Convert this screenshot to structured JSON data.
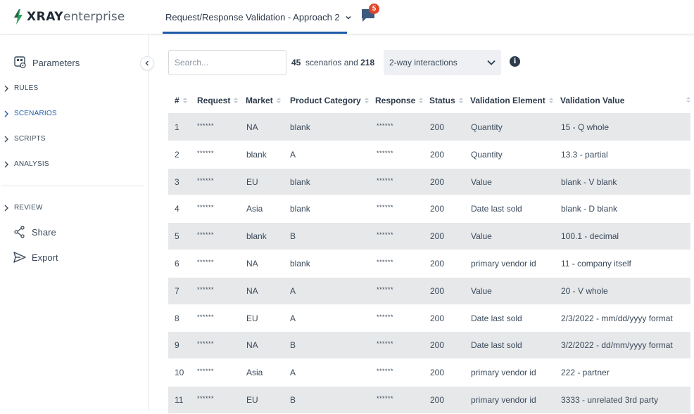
{
  "header": {
    "logo_strong": "XRAY",
    "logo_light": "enterprise",
    "project_title": "Request/Response Validation - Approach 2",
    "notification_count": "5"
  },
  "sidebar": {
    "parameters_label": "Parameters",
    "sections": [
      {
        "label": "RULES",
        "active": false
      },
      {
        "label": "SCENARIOS",
        "active": true
      },
      {
        "label": "SCRIPTS",
        "active": false
      },
      {
        "label": "ANALYSIS",
        "active": false
      },
      {
        "label": "REVIEW",
        "active": false
      }
    ],
    "share_label": "Share",
    "export_label": "Export"
  },
  "toolbar": {
    "search_placeholder": "Search...",
    "scenario_count": "45",
    "scenarios_and": "scenarios and",
    "interaction_count": "218",
    "interaction_select": "2-way interactions"
  },
  "table": {
    "columns": [
      "#",
      "Request",
      "Market",
      "Product Category",
      "Response",
      "Status",
      "Validation Element",
      "Validation Value"
    ],
    "rows": [
      [
        "1",
        "******",
        "NA",
        "blank",
        "******",
        "200",
        "Quantity",
        "15 - Q whole"
      ],
      [
        "2",
        "******",
        "blank",
        "A",
        "******",
        "200",
        "Quantity",
        "13.3 - partial"
      ],
      [
        "3",
        "******",
        "EU",
        "blank",
        "******",
        "200",
        "Value",
        "blank - V blank"
      ],
      [
        "4",
        "******",
        "Asia",
        "blank",
        "******",
        "200",
        "Date last sold",
        "blank - D blank"
      ],
      [
        "5",
        "******",
        "blank",
        "B",
        "******",
        "200",
        "Value",
        "100.1 - decimal"
      ],
      [
        "6",
        "******",
        "NA",
        "blank",
        "******",
        "200",
        "primary vendor id",
        "11 - company itself"
      ],
      [
        "7",
        "******",
        "NA",
        "A",
        "******",
        "200",
        "Value",
        "20 - V whole"
      ],
      [
        "8",
        "******",
        "EU",
        "A",
        "******",
        "200",
        "Date last sold",
        "2/3/2022 - mm/dd/yyyy format"
      ],
      [
        "9",
        "******",
        "NA",
        "B",
        "******",
        "200",
        "Date last sold",
        "3/2/2022 - dd/mm/yyyy format"
      ],
      [
        "10",
        "******",
        "Asia",
        "A",
        "******",
        "200",
        "primary vendor id",
        "222 - partner"
      ],
      [
        "11",
        "******",
        "EU",
        "B",
        "******",
        "200",
        "primary vendor id",
        "3333 - unrelated 3rd party"
      ]
    ]
  },
  "colors": {
    "accent": "#1e5aa8",
    "badge": "#e2472c",
    "row_stripe": "#e6e8ea",
    "logo_bolt": "#2e9d5b"
  }
}
